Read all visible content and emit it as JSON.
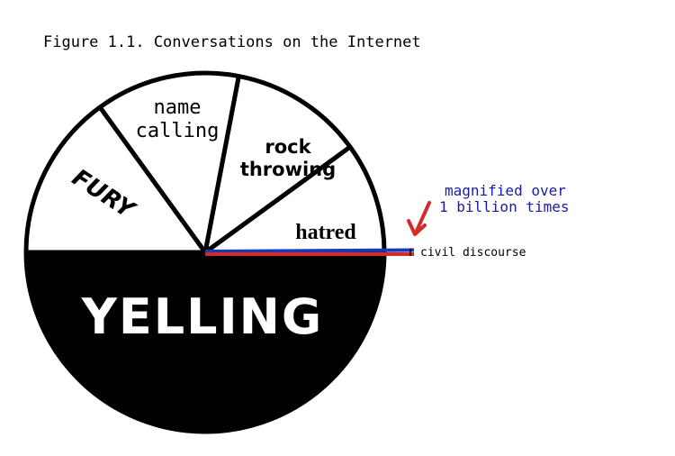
{
  "figure_title": "Figure 1.1.  Conversations on the Internet",
  "annotation": {
    "line1": "magnified over",
    "line2": "1 billion times",
    "label": "civil discourse",
    "text_color": "#1a1aa8",
    "arrow_color": "#d32a2a"
  },
  "chart_data": {
    "type": "pie",
    "title": "Figure 1.1.  Conversations on the Internet",
    "slices": [
      {
        "label": "YELLING",
        "value": 50,
        "fill": "#000000",
        "text_color": "#ffffff"
      },
      {
        "label": "FURY",
        "value": 15,
        "fill": "#ffffff",
        "text_color": "#000000"
      },
      {
        "label": "name calling",
        "value": 13,
        "fill": "#ffffff",
        "text_color": "#000000"
      },
      {
        "label": "rock throwing",
        "value": 12,
        "fill": "#ffffff",
        "text_color": "#000000"
      },
      {
        "label": "hatred",
        "value": 10,
        "fill": "#ffffff",
        "text_color": "#000000"
      },
      {
        "label": "civil discourse",
        "value": 0,
        "fill": "#d32a2a",
        "text_color": "#000000"
      }
    ],
    "civil_discourse_stripe_colors": [
      "#1a3ab8",
      "#d32a2a"
    ]
  }
}
